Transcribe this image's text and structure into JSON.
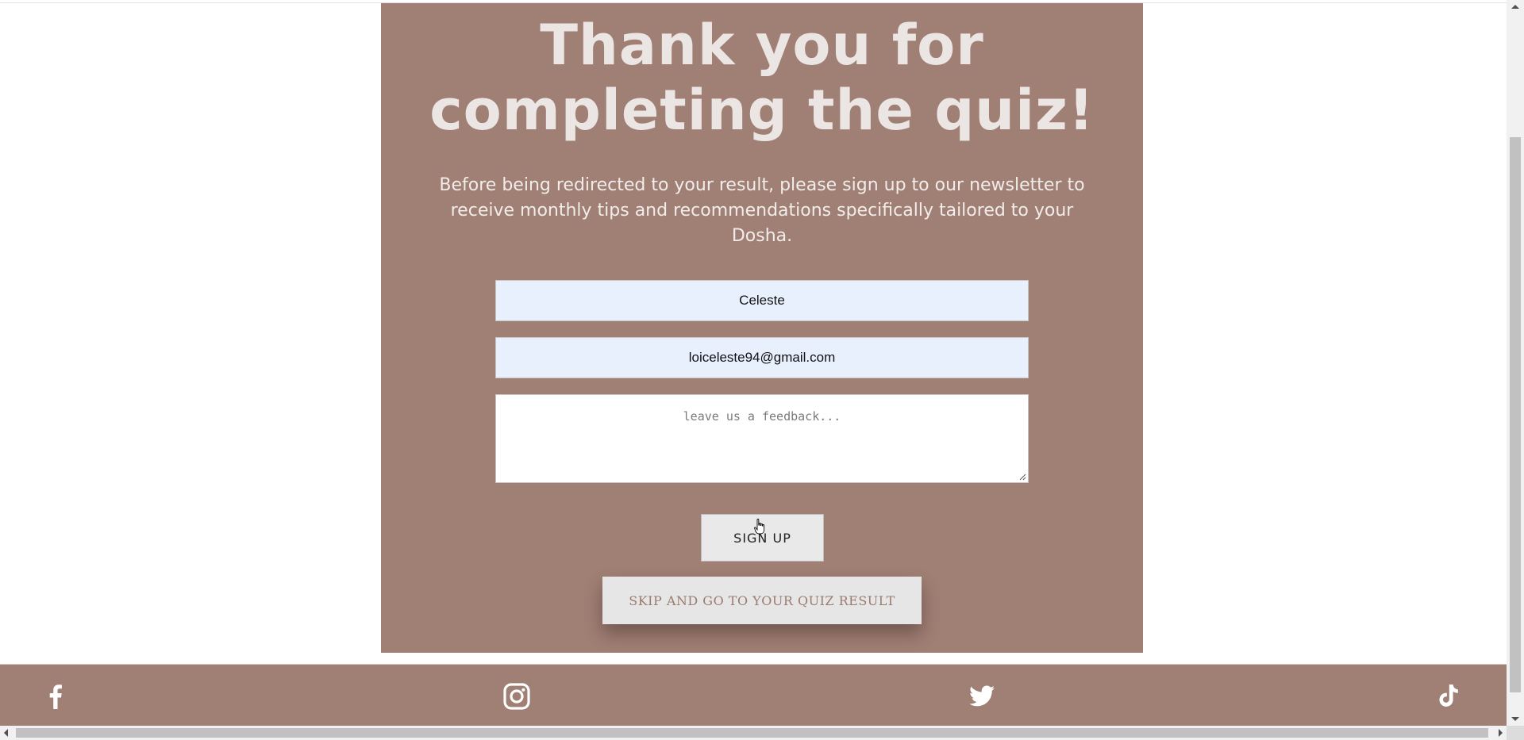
{
  "quiz_complete": {
    "title": "Thank you for completing the quiz!",
    "intro": "Before being redirected to your result, please sign up to our newsletter to receive monthly tips and recommendations specifically tailored to your Dosha.",
    "form": {
      "name_value": "Celeste",
      "email_value": "loiceleste94@gmail.com",
      "feedback_placeholder": "leave us a feedback...",
      "signup_label": "SIGN UP",
      "skip_label": "SKIP AND GO TO YOUR QUIZ RESULT"
    }
  },
  "footer": {
    "social_icons": [
      "facebook-icon",
      "instagram-icon",
      "twitter-icon",
      "tiktok-icon"
    ]
  },
  "colors": {
    "card_background": "#a07f74",
    "title_text": "#ebe5e3",
    "input_autofill": "#e8f0fe",
    "skip_text": "#9b7b70"
  }
}
